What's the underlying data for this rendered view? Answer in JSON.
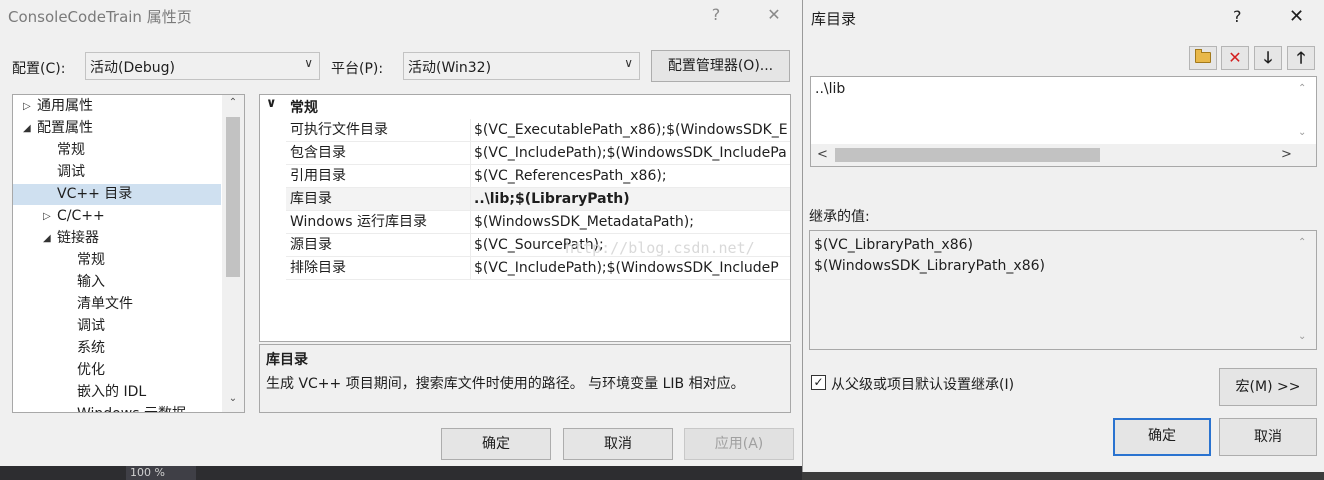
{
  "prop_dialog": {
    "title": "ConsoleCodeTrain 属性页",
    "help_glyph": "?",
    "close_glyph": "✕",
    "config_label": "配置(C):",
    "config_value": "活动(Debug)",
    "platform_label": "平台(P):",
    "platform_value": "活动(Win32)",
    "config_manager_button": "配置管理器(O)...",
    "tree": [
      {
        "label": "通用属性",
        "arrow": "▷"
      },
      {
        "label": "配置属性",
        "arrow": "◢"
      },
      {
        "label": "常规",
        "arrow": ""
      },
      {
        "label": "调试",
        "arrow": ""
      },
      {
        "label": "VC++ 目录",
        "arrow": ""
      },
      {
        "label": "C/C++",
        "arrow": "▷"
      },
      {
        "label": "链接器",
        "arrow": "◢"
      },
      {
        "label": "常规",
        "arrow": ""
      },
      {
        "label": "输入",
        "arrow": ""
      },
      {
        "label": "清单文件",
        "arrow": ""
      },
      {
        "label": "调试",
        "arrow": ""
      },
      {
        "label": "系统",
        "arrow": ""
      },
      {
        "label": "优化",
        "arrow": ""
      },
      {
        "label": "嵌入的 IDL",
        "arrow": ""
      },
      {
        "label": "Windows 元数据",
        "arrow": ""
      }
    ],
    "grid": {
      "section_arrow": "∨",
      "section": "常规",
      "rows": [
        {
          "name": "可执行文件目录",
          "value": "$(VC_ExecutablePath_x86);$(WindowsSDK_E"
        },
        {
          "name": "包含目录",
          "value": "$(VC_IncludePath);$(WindowsSDK_IncludePa"
        },
        {
          "name": "引用目录",
          "value": "$(VC_ReferencesPath_x86);"
        },
        {
          "name": "库目录",
          "value": "..\\lib;$(LibraryPath)"
        },
        {
          "name": "Windows 运行库目录",
          "value": "$(WindowsSDK_MetadataPath);"
        },
        {
          "name": "源目录",
          "value": "$(VC_SourcePath);"
        },
        {
          "name": "排除目录",
          "value": "$(VC_IncludePath);$(WindowsSDK_IncludeP"
        }
      ]
    },
    "watermark": "http://blog.csdn.net/",
    "description": {
      "title": "库目录",
      "text": "生成 VC++ 项目期间，搜索库文件时使用的路径。 与环境变量 LIB 相对应。"
    },
    "ok_button": "确定",
    "cancel_button": "取消",
    "apply_button": "应用(A)",
    "zoom": "100 %"
  },
  "lib_dialog": {
    "title": "库目录",
    "help_glyph": "?",
    "close_glyph": "✕",
    "toolbar": {
      "new_folder_icon": "folder-icon",
      "delete_icon": "✕",
      "down_icon": "🡓",
      "up_icon": "🡑"
    },
    "edit_value": "..\\lib",
    "inherited_label": "继承的值:",
    "inherited_values": [
      "$(VC_LibraryPath_x86)",
      "$(WindowsSDK_LibraryPath_x86)"
    ],
    "inherit_checkbox_label": "从父级或项目默认设置继承(I)",
    "inherit_checked": true,
    "check_glyph": "✓",
    "macro_button": "宏(M) >>",
    "ok_button": "确定",
    "cancel_button": "取消"
  }
}
